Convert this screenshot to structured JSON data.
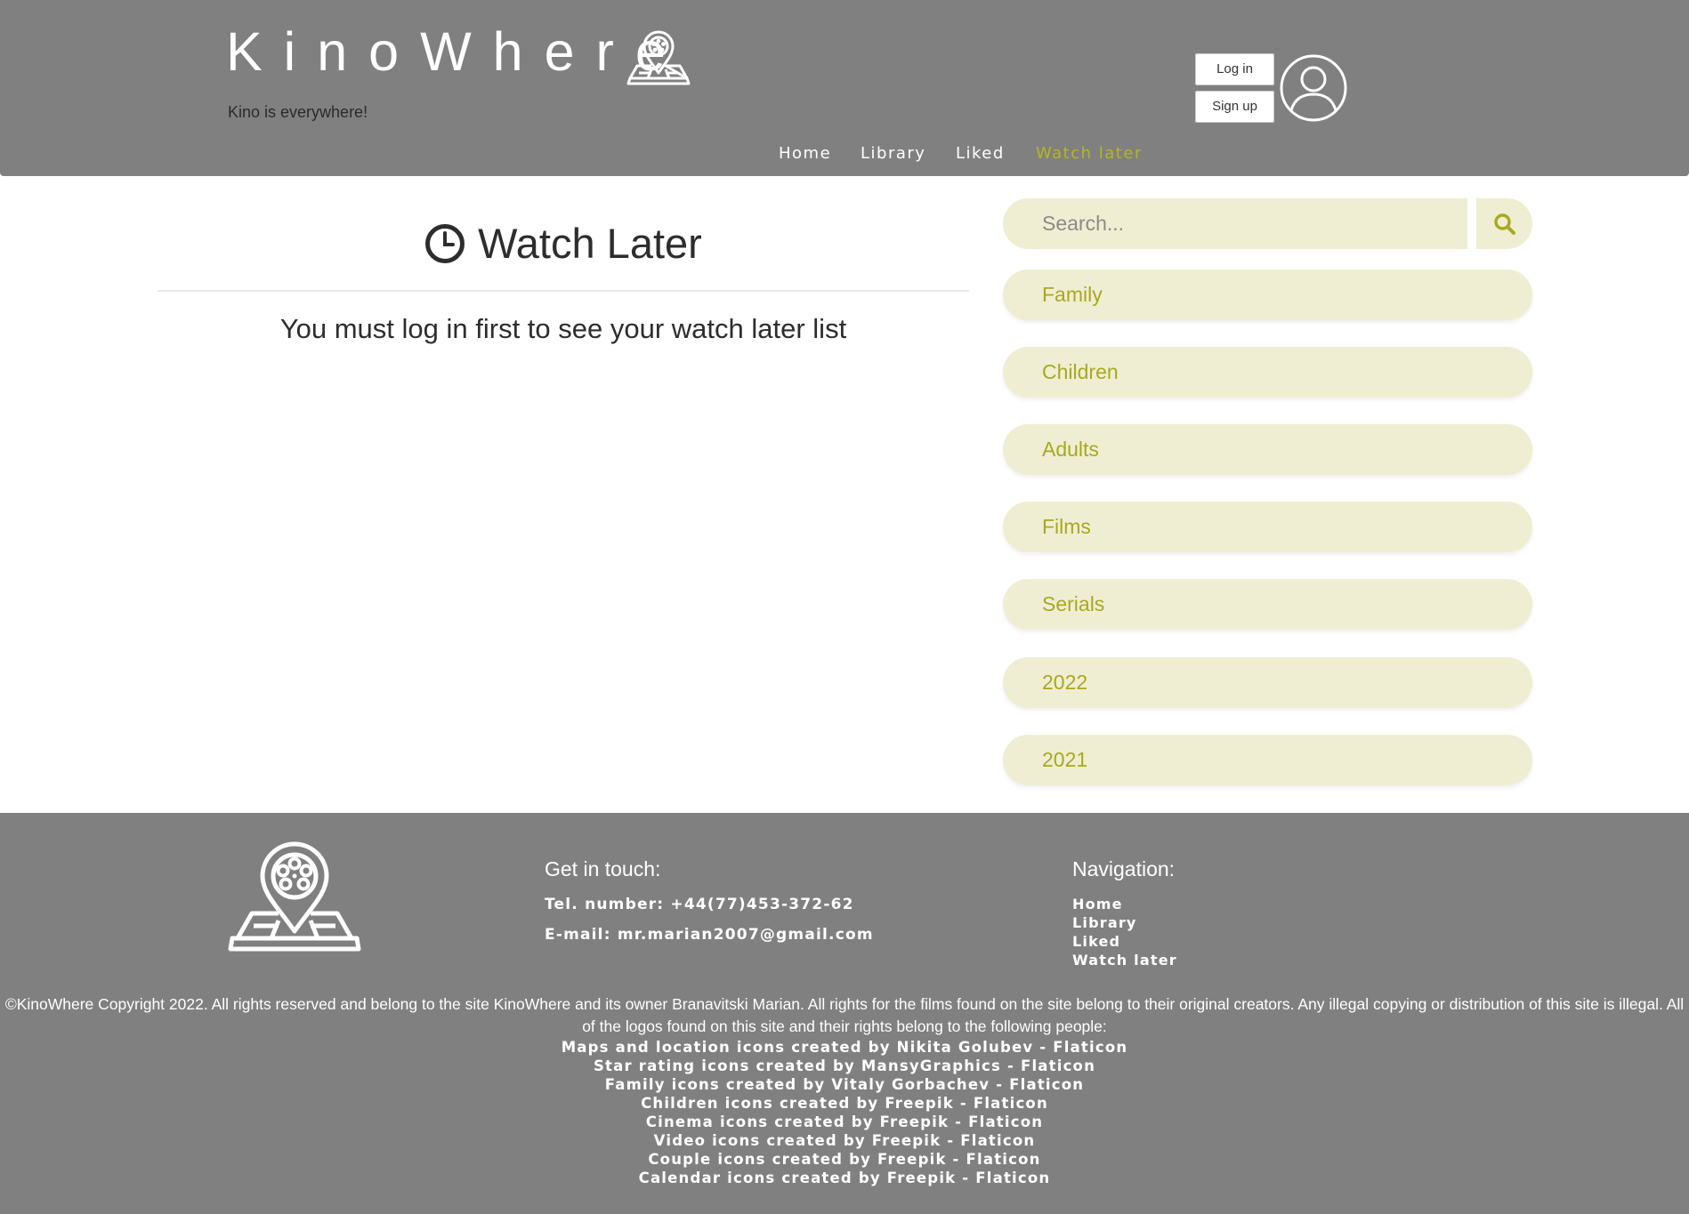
{
  "header": {
    "brand": "KinoWhere",
    "tagline": "Kino is everywhere!",
    "login_label": "Log in",
    "signup_label": "Sign up"
  },
  "nav": {
    "items": [
      {
        "label": "Home"
      },
      {
        "label": "Library"
      },
      {
        "label": "Liked"
      },
      {
        "label": "Watch later",
        "active": true
      }
    ]
  },
  "main": {
    "title": "Watch Later",
    "message": "You must log in first to see your watch later list"
  },
  "sidebar": {
    "search_placeholder": "Search...",
    "categories": [
      "Family",
      "Children",
      "Adults",
      "Films",
      "Serials",
      "2022",
      "2021"
    ]
  },
  "footer": {
    "contact_title": "Get in touch:",
    "phone": "Tel. number: +44(77)453-372-62",
    "email": "E-mail: mr.marian2007@gmail.com",
    "nav_title": "Navigation:",
    "nav_items": [
      "Home",
      "Library",
      "Liked",
      "Watch later"
    ],
    "copyright": "©KinoWhere Copyright 2022. All rights reserved and belong to the site KinoWhere and its owner Branavitski Marian. All rights for the films found on the site belong to their original creators. Any illegal copying or distribution of this site is illegal. All of the logos found on this site and their rights belong to the following people:",
    "credits": [
      "Maps and location icons created by Nikita Golubev - Flaticon",
      "Star rating icons created by MansyGraphics - Flaticon",
      "Family icons created by Vitaly Gorbachev - Flaticon",
      "Children icons created by Freepik - Flaticon",
      "Cinema icons created by Freepik - Flaticon",
      "Video icons created by Freepik - Flaticon",
      "Couple icons created by Freepik - Flaticon",
      "Calendar icons created by Freepik - Flaticon"
    ]
  },
  "colors": {
    "header_bg": "#808080",
    "accent": "#b5b524",
    "sidebar_item_bg": "#efeed3",
    "sidebar_item_text": "#a9a81f"
  },
  "icons": [
    "film-reel-location-icon",
    "user-avatar-icon",
    "clock-icon",
    "search-icon"
  ]
}
